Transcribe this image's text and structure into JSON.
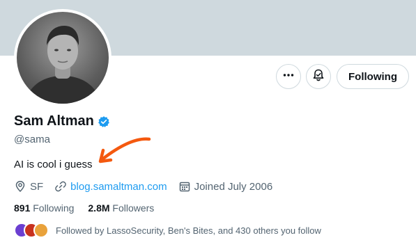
{
  "profile": {
    "name": "Sam Altman",
    "handle": "@sama",
    "bio": "AI is cool i guess",
    "location": "SF",
    "website": "blog.samaltman.com",
    "joined": "Joined July 2006",
    "verified": true
  },
  "actions": {
    "follow_label": "Following"
  },
  "stats": {
    "following_count": "891",
    "following_label": "Following",
    "followers_count": "2.8M",
    "followers_label": "Followers"
  },
  "followed_by": {
    "text": "Followed by LassoSecurity, Ben's Bites, and 430 others you follow"
  },
  "colors": {
    "banner": "#cfd9de",
    "accent": "#1d9bf0",
    "arrow": "#f4590f",
    "secondary_text": "#536471"
  },
  "icons": {
    "more": "more-horizontal-icon",
    "bell": "notification-bell-icon",
    "verified": "verified-badge-icon",
    "location": "location-pin-icon",
    "link": "link-icon",
    "calendar": "calendar-icon"
  }
}
